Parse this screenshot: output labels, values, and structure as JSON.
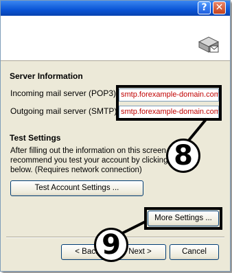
{
  "window": {
    "help_glyph": "?",
    "close_glyph": "✕"
  },
  "server_info": {
    "title": "Server Information",
    "incoming_label": "Incoming mail server (POP3):",
    "incoming_value": "smtp.forexample-domain.com",
    "outgoing_label": "Outgoing mail server (SMTP):",
    "outgoing_value": "smtp.forexample-domain.com"
  },
  "test_settings": {
    "title": "Test Settings",
    "description_line1": "After filling out the information on this screen,",
    "description_line2": "recommend you test your account by clicking th",
    "description_line3": "below. (Requires network connection)",
    "test_button": "Test Account Settings ..."
  },
  "more_settings_button": "More Settings ...",
  "nav": {
    "back_label": "< Back",
    "next_label": "Next >",
    "cancel_label": "Cancel"
  },
  "callouts": {
    "step_8": "8",
    "step_9": "9"
  },
  "colors": {
    "field_text": "#c00000",
    "highlight": "#000000",
    "dialog_bg": "#ece9d8",
    "titlebar": "#0a55d6"
  },
  "icons": {
    "header_icon": "mail-server-icon"
  }
}
